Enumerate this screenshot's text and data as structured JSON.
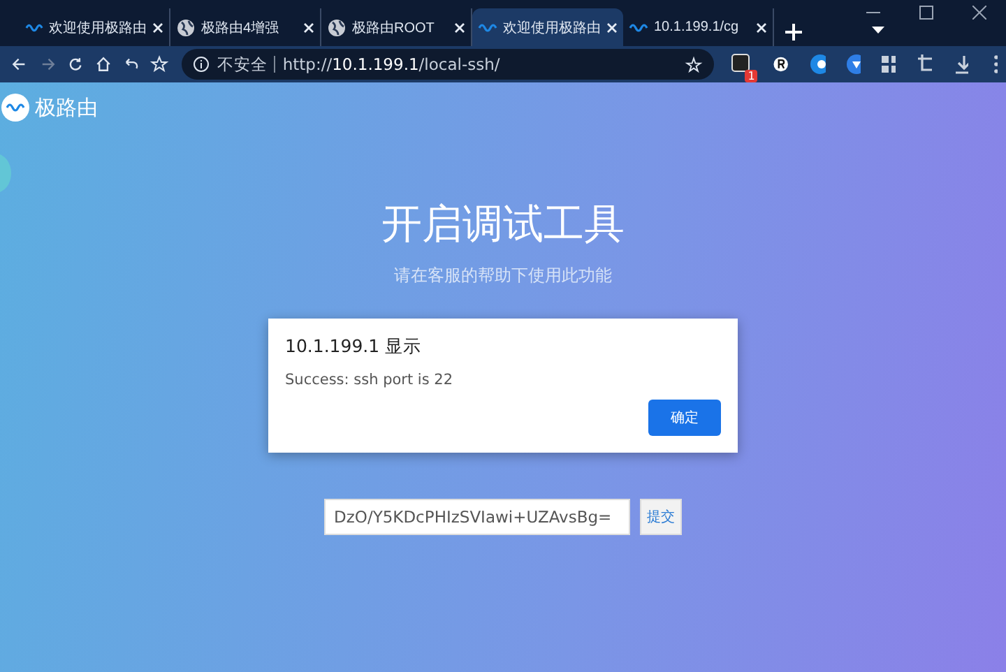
{
  "tabs": [
    {
      "kind": "router",
      "title": "欢迎使用极路由",
      "selected": false
    },
    {
      "kind": "web",
      "title": "极路由4增强",
      "selected": false
    },
    {
      "kind": "web",
      "title": "极路由ROOT",
      "selected": false
    },
    {
      "kind": "router",
      "title": "欢迎使用极路由",
      "selected": true
    },
    {
      "kind": "router",
      "title": "10.1.199.1/cg",
      "selected": false
    }
  ],
  "toolbar": {
    "security": "不安全",
    "url_scheme": "http://",
    "url_host": "10.1.199.1",
    "url_path": "/local-ssh/",
    "extension_badge": "1"
  },
  "page": {
    "brand": "极路由",
    "title": "开启调试工具",
    "subtitle": "请在客服的帮助下使用此功能",
    "dialog": {
      "title": "10.1.199.1 显示",
      "message": "Success: ssh port is 22",
      "button": "确定"
    },
    "token": {
      "value": "DzO/Y5KDcPHIzSVIawi+UZAvsBg=",
      "button": "提交"
    }
  }
}
